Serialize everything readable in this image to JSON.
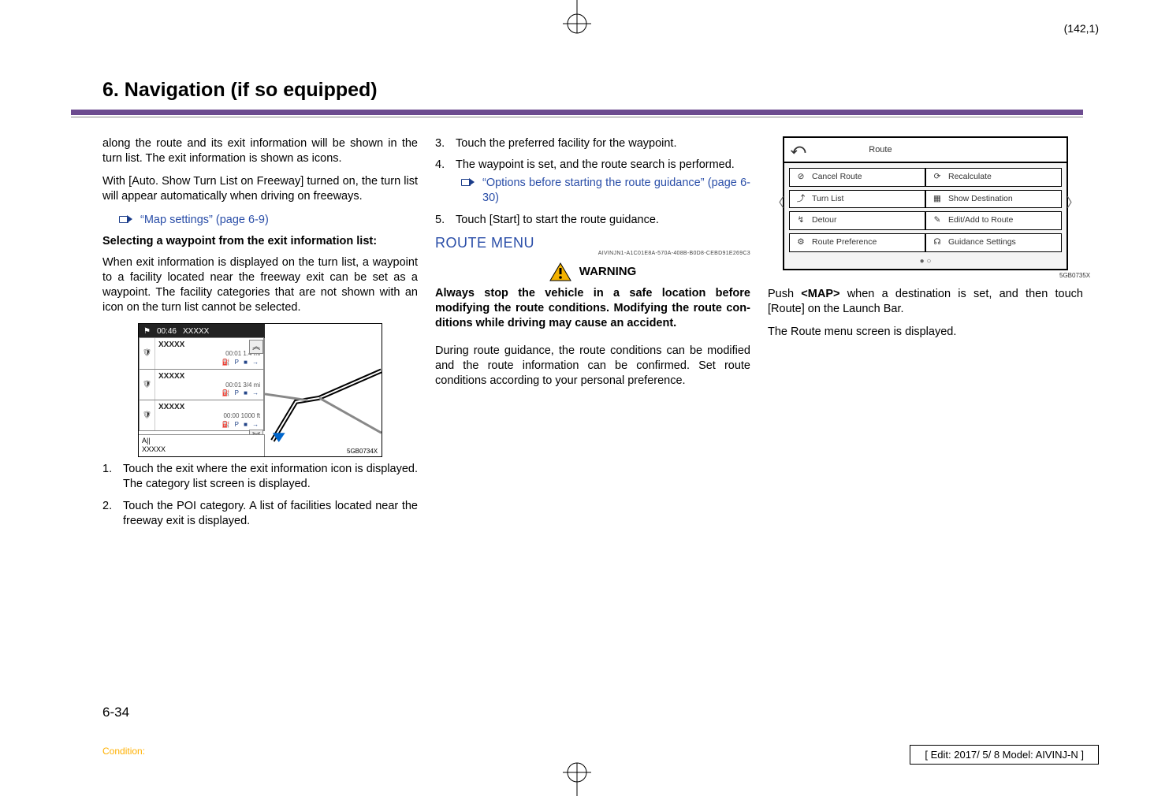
{
  "meta": {
    "pageCoord": "(142,1)",
    "pageNum": "6-34",
    "condition": "Condition:",
    "editBox": "[ Edit: 2017/ 5/ 8    Model:  AIVINJ-N ]"
  },
  "chapterTitle": "6. Navigation (if so equipped)",
  "col1": {
    "p1": "along the route and its exit information will be shown in the turn list. The exit information is shown as icons.",
    "p2": "With [Auto. Show Turn List on Freeway] turned on, the turn list will appear auto­matically when driving on freeways.",
    "link1": "“Map settings” (page 6-9)",
    "sub1": "Selecting a waypoint from the exit information list:",
    "p3": "When exit information is displayed on the turn list, a waypoint to a facility located near the freeway exit can be set as a waypoint. The facility categories that are not shown with an icon on the turn list cannot be selected.",
    "imgLabel": "5GB0734X",
    "turnlist": {
      "topbar_time": "00:46",
      "topbar_dest": "XXXXX",
      "rows": [
        {
          "name": "XXXXX",
          "meta": "00:01     1.4 mi"
        },
        {
          "name": "XXXXX",
          "meta": "00:01    3/4 mi"
        },
        {
          "name": "XXXXX",
          "meta": "00:00   1000 ft"
        }
      ],
      "bottom_name": "A||",
      "bottom_dest": "XXXXX",
      "icons": "⛽  P ■ →"
    },
    "list": [
      "Touch the exit where the exit informa­tion icon is displayed. The category list screen is displayed.",
      "Touch the POI category. A list of facilities located near the freeway exit is displayed."
    ]
  },
  "col2": {
    "list": [
      {
        "n": "3.",
        "t": "Touch the preferred facility for the waypoint."
      },
      {
        "n": "4.",
        "t": "The waypoint is set, and the route search is performed.",
        "link": "“Options before starting the route guidance” (page 6-30)"
      },
      {
        "n": "5.",
        "t": "Touch [Start] to start the route gui­dance."
      }
    ],
    "section": "ROUTE MENU",
    "guid": "AIVINJN1-A1C01E8A-570A-408B-B0D8-CEBD91E269C3",
    "warnTitle": "WARNING",
    "warnBody": "Always stop the vehicle in a safe location before modifying the route conditions. Modifying the route con­ditions while driving may cause an accident.",
    "p1": "During route guidance, the route condi­tions can be modified and the route information can be confirmed. Set route conditions according to your personal preference."
  },
  "col3": {
    "route": {
      "title": "Route",
      "cells": [
        "Cancel Route",
        "Recalculate",
        "Turn List",
        "Show Destination",
        "Detour",
        "Edit/Add to Route",
        "Route Preference",
        "Guidance Settings"
      ]
    },
    "imgLabel": "5GB0735X",
    "p1": "Push <MAP> when a destination is set, and then touch [Route] on the Launch Bar.",
    "p1_bold": "<MAP>",
    "p2": "The Route menu screen is displayed."
  }
}
